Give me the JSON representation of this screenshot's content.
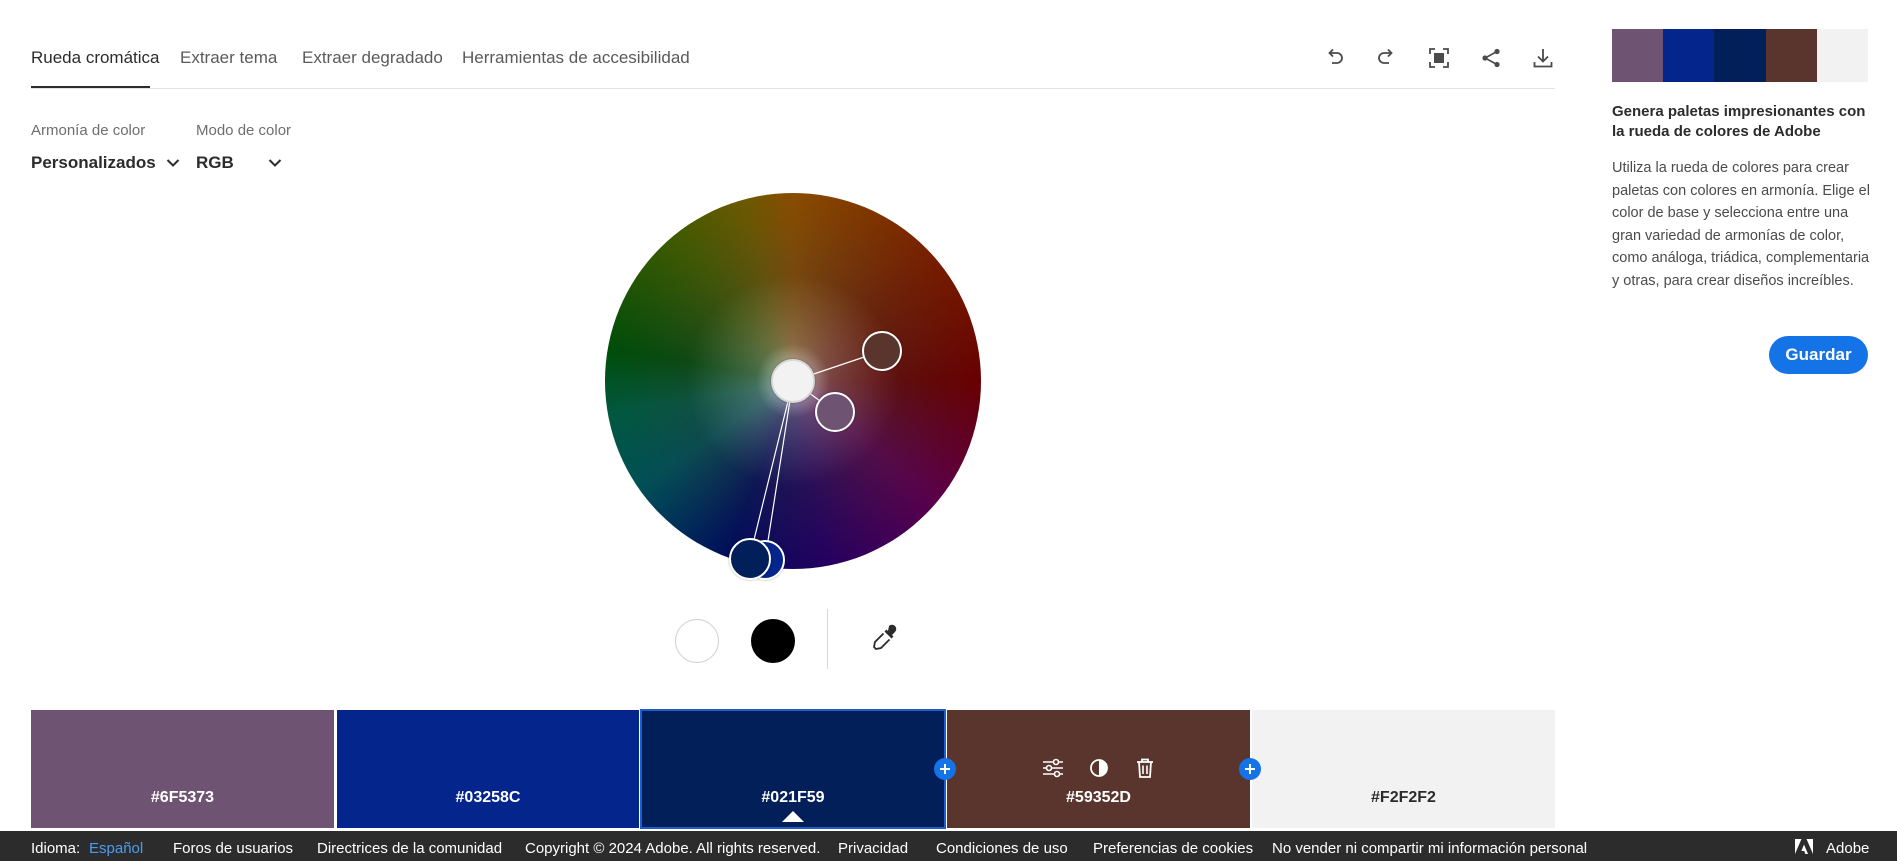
{
  "tabs": [
    {
      "label": "Rueda cromática",
      "active": true
    },
    {
      "label": "Extraer tema",
      "active": false
    },
    {
      "label": "Extraer degradado",
      "active": false
    },
    {
      "label": "Herramientas de accesibilidad",
      "active": false
    }
  ],
  "toolbar": {
    "icons": [
      "undo-icon",
      "redo-icon",
      "fullscreen-icon",
      "share-icon",
      "download-icon"
    ]
  },
  "controls": {
    "harmony": {
      "label": "Armonía de color",
      "value": "Personalizados"
    },
    "mode": {
      "label": "Modo de color",
      "value": "RGB"
    }
  },
  "wheel_tools": {
    "icons": [
      "white-swatch-icon",
      "black-swatch-icon",
      "eyedropper-icon"
    ],
    "white": "#FFFFFF",
    "black": "#000000"
  },
  "palette": [
    {
      "hex": "#6F5373",
      "color": "#6f5373",
      "text": "light",
      "selected": false
    },
    {
      "hex": "#03258C",
      "color": "#03258c",
      "text": "light",
      "selected": false
    },
    {
      "hex": "#021F59",
      "color": "#021f59",
      "text": "light",
      "selected": true
    },
    {
      "hex": "#59352D",
      "color": "#59352d",
      "text": "light",
      "selected": false
    },
    {
      "hex": "#F2F2F2",
      "color": "#f2f2f2",
      "text": "dark",
      "selected": false
    }
  ],
  "swatch_tools": [
    "sliders-icon",
    "contrast-icon",
    "trash-icon"
  ],
  "add_icon": "plus-icon",
  "right_panel": {
    "title": "Genera paletas impresionantes con la rueda de colores de Adobe",
    "body": "Utiliza la rueda de colores para crear paletas con colores en armonía. Elige el color de base y selecciona entre una gran variedad de armonías de color, como análoga, triádica, complementaria y otras, para crear diseños increíbles.",
    "save_label": "Guardar"
  },
  "footer": {
    "language_label": "Idioma:",
    "language_value": "Español",
    "links": [
      "Foros de usuarios",
      "Directrices de la comunidad",
      "Copyright © 2024 Adobe. All rights reserved.",
      "Privacidad",
      "Condiciones de uso",
      "Preferencias de cookies",
      "No vender ni compartir mi información personal"
    ],
    "brand": "Adobe",
    "brand_icon": "adobe-logo-icon"
  },
  "accent_color": "#1473E6"
}
